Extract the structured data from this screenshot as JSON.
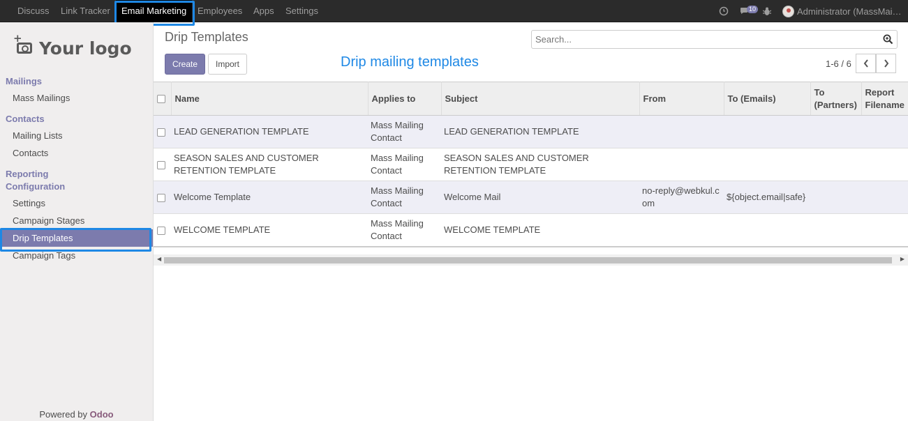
{
  "navbar": {
    "apps": [
      "Discuss",
      "Link Tracker",
      "Email Marketing",
      "Employees",
      "Apps",
      "Settings"
    ],
    "active_app": "Email Marketing",
    "message_count": "10",
    "user": "Administrator (MassMai…"
  },
  "sidebar": {
    "logo_text": "Your logo",
    "sections": {
      "mailings": "Mailings",
      "contacts": "Contacts",
      "reporting": "Reporting",
      "configuration": "Configuration"
    },
    "items": {
      "mass_mailings": "Mass Mailings",
      "mailing_lists": "Mailing Lists",
      "contacts": "Contacts",
      "settings": "Settings",
      "campaign_stages": "Campaign Stages",
      "drip_templates": "Drip Templates",
      "campaign_tags": "Campaign Tags"
    },
    "powered_by": "Powered by",
    "powered_brand": "Odoo"
  },
  "control_panel": {
    "title": "Drip Templates",
    "create_label": "Create",
    "import_label": "Import",
    "annotation": "Drip mailing templates",
    "search_placeholder": "Search...",
    "pager": "1-6 / 6"
  },
  "table": {
    "columns": {
      "name": "Name",
      "applies_to": "Applies to",
      "subject": "Subject",
      "from": "From",
      "to_emails": "To (Emails)",
      "to_partners": "To (Partners)",
      "report_filename": "Report Filename"
    },
    "rows": [
      {
        "name": "LEAD GENERATION TEMPLATE",
        "applies_to": "Mass Mailing Contact",
        "subject": "LEAD GENERATION TEMPLATE",
        "from": "",
        "to_emails": ""
      },
      {
        "name": "SEASON SALES AND CUSTOMER RETENTION TEMPLATE",
        "applies_to": "Mass Mailing Contact",
        "subject": "SEASON SALES AND CUSTOMER RETENTION TEMPLATE",
        "from": "",
        "to_emails": ""
      },
      {
        "name": "Welcome Template",
        "applies_to": "Mass Mailing Contact",
        "subject": "Welcome Mail",
        "from": "no-reply@webkul.com",
        "to_emails": "${object.email|safe}"
      },
      {
        "name": "WELCOME TEMPLATE",
        "applies_to": "Mass Mailing Contact",
        "subject": "WELCOME TEMPLATE",
        "from": "",
        "to_emails": ""
      }
    ]
  },
  "colors": {
    "brand": "#7c7bad",
    "annotation_blue": "#1e88e5",
    "navbar": "#2b2b2b"
  }
}
